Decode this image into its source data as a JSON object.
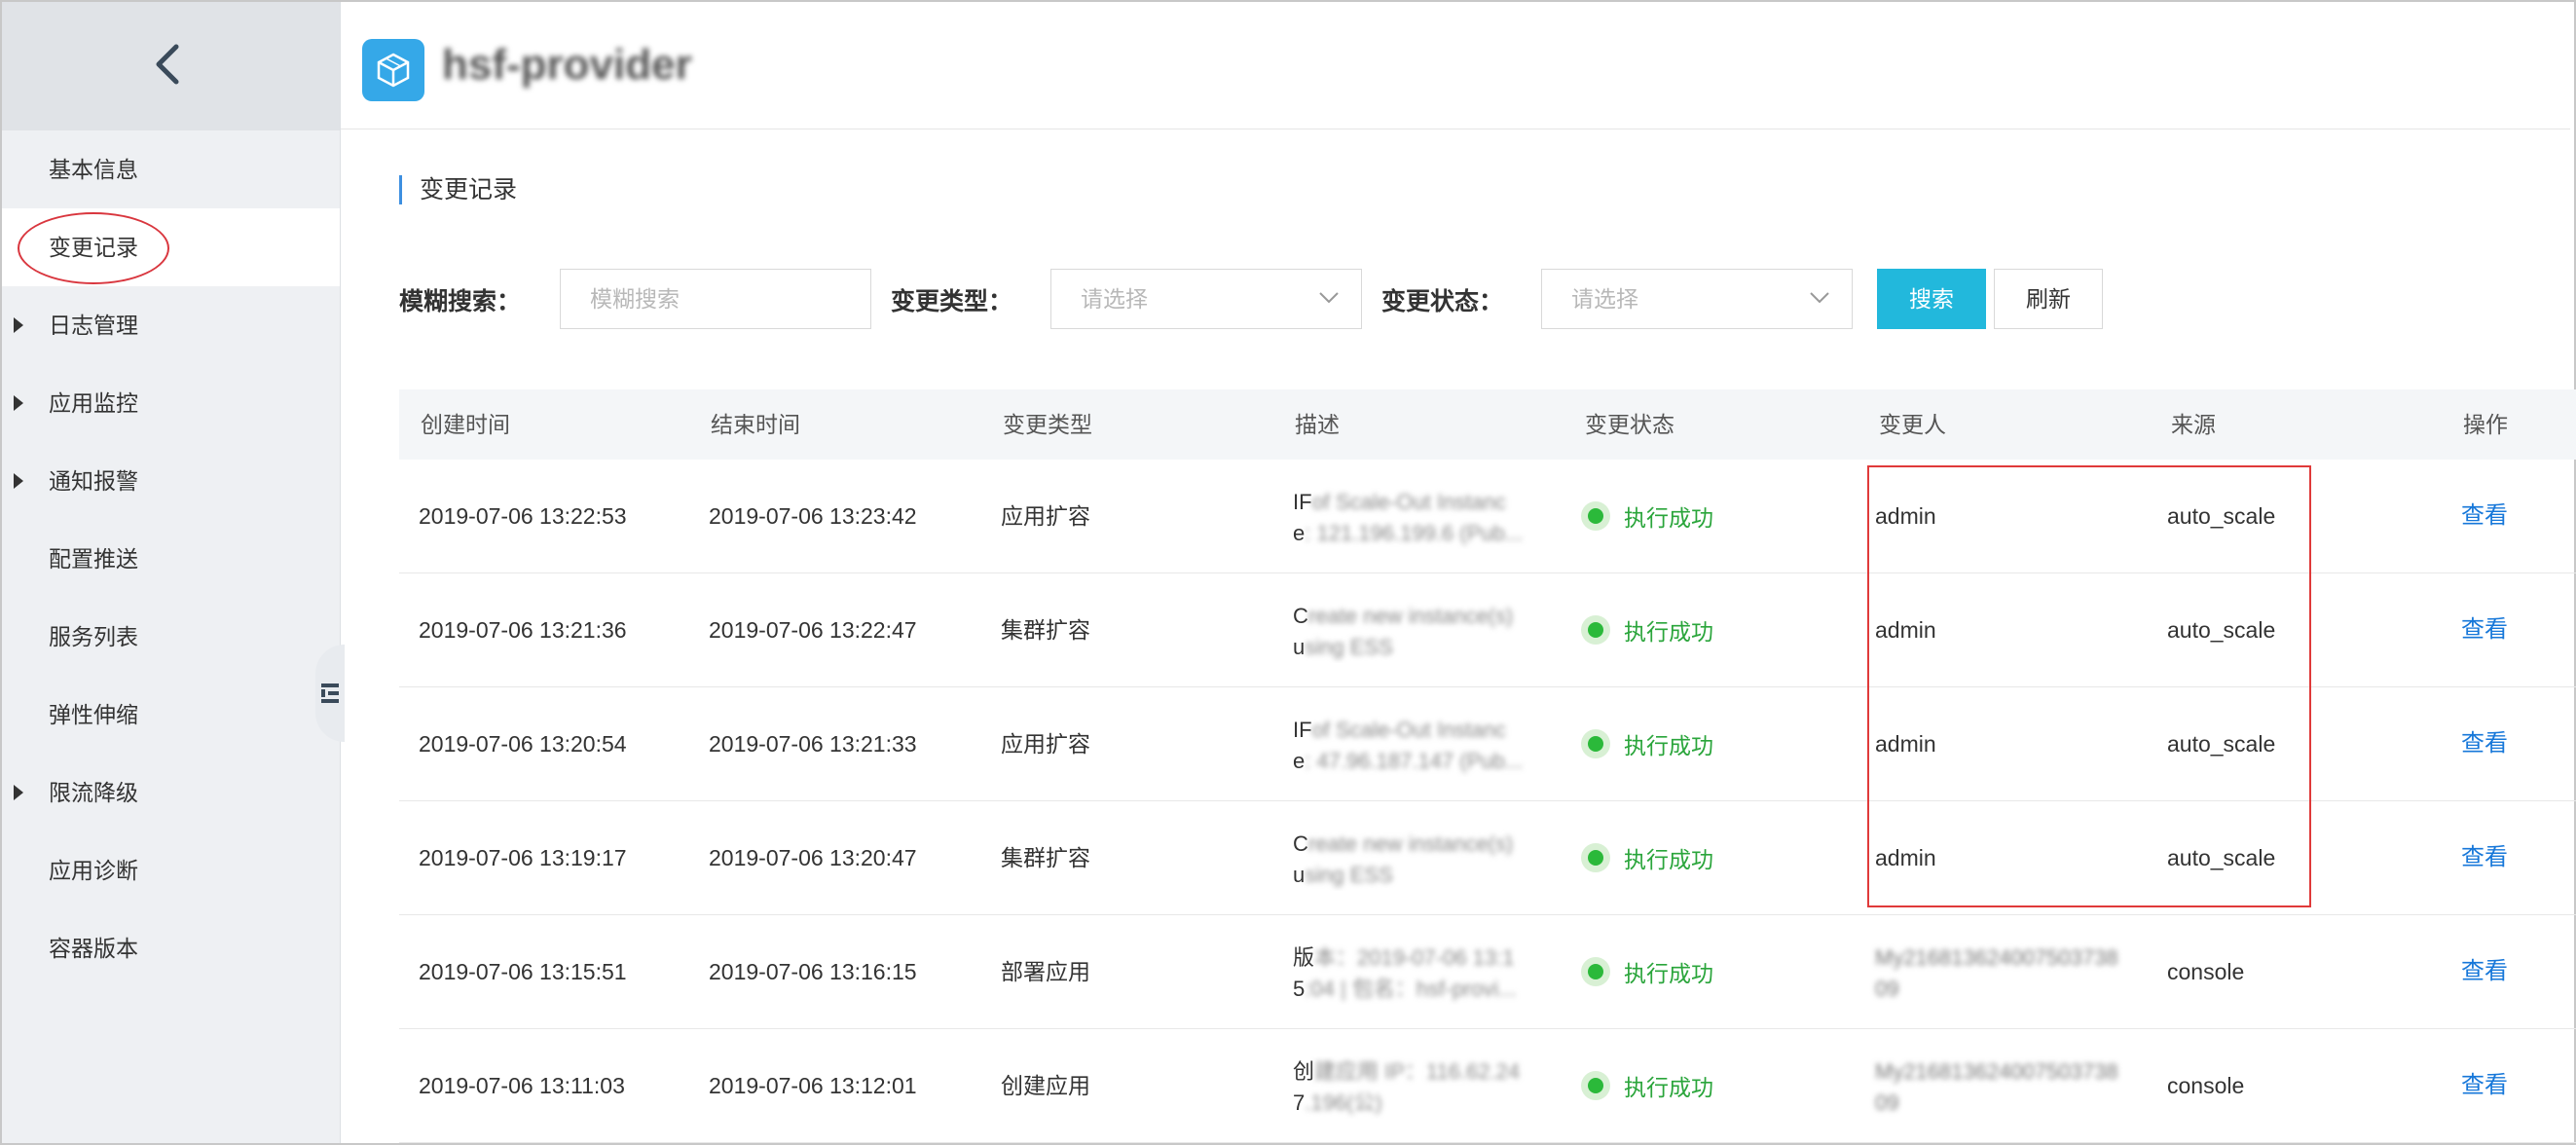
{
  "app": {
    "name": "hsf-provider"
  },
  "sidebar": {
    "items": [
      {
        "label": "基本信息",
        "has_caret": false,
        "active": false
      },
      {
        "label": "变更记录",
        "has_caret": false,
        "active": true
      },
      {
        "label": "日志管理",
        "has_caret": true,
        "active": false
      },
      {
        "label": "应用监控",
        "has_caret": true,
        "active": false
      },
      {
        "label": "通知报警",
        "has_caret": true,
        "active": false
      },
      {
        "label": "配置推送",
        "has_caret": false,
        "active": false
      },
      {
        "label": "服务列表",
        "has_caret": false,
        "active": false
      },
      {
        "label": "弹性伸缩",
        "has_caret": false,
        "active": false
      },
      {
        "label": "限流降级",
        "has_caret": true,
        "active": false
      },
      {
        "label": "应用诊断",
        "has_caret": false,
        "active": false
      },
      {
        "label": "容器版本",
        "has_caret": false,
        "active": false
      }
    ]
  },
  "main": {
    "section_title": "变更记录",
    "filters": {
      "fuzzy_label": "模糊搜索：",
      "fuzzy_placeholder": "模糊搜索",
      "type_label": "变更类型：",
      "type_placeholder": "请选择",
      "status_label": "变更状态：",
      "status_placeholder": "请选择",
      "search_button": "搜索",
      "refresh_button": "刷新"
    },
    "table": {
      "columns": [
        "创建时间",
        "结束时间",
        "变更类型",
        "描述",
        "变更状态",
        "变更人",
        "来源",
        "操作"
      ],
      "rows": [
        {
          "created": "2019-07-06 13:22:53",
          "ended": "2019-07-06 13:23:42",
          "type": "应用扩容",
          "desc_line1_start": "IF",
          "desc_line1_rest": "of Scale-Out Instanc",
          "desc_line2_start": "e",
          "desc_line2_rest": ": 121.196.199.6 (Pub...",
          "status": "执行成功",
          "operator": "admin",
          "source": "auto_scale",
          "action": "查看"
        },
        {
          "created": "2019-07-06 13:21:36",
          "ended": "2019-07-06 13:22:47",
          "type": "集群扩容",
          "desc_line1_start": "C",
          "desc_line1_rest": "reate new instance(s)",
          "desc_line2_start": "u",
          "desc_line2_rest": "sing ESS",
          "status": "执行成功",
          "operator": "admin",
          "source": "auto_scale",
          "action": "查看"
        },
        {
          "created": "2019-07-06 13:20:54",
          "ended": "2019-07-06 13:21:33",
          "type": "应用扩容",
          "desc_line1_start": "IF",
          "desc_line1_rest": "of Scale-Out Instanc",
          "desc_line2_start": "e",
          "desc_line2_rest": ": 47.96.187.147 (Pub...",
          "status": "执行成功",
          "operator": "admin",
          "source": "auto_scale",
          "action": "查看"
        },
        {
          "created": "2019-07-06 13:19:17",
          "ended": "2019-07-06 13:20:47",
          "type": "集群扩容",
          "desc_line1_start": "C",
          "desc_line1_rest": "reate new instance(s)",
          "desc_line2_start": "u",
          "desc_line2_rest": "sing ESS",
          "status": "执行成功",
          "operator": "admin",
          "source": "auto_scale",
          "action": "查看"
        },
        {
          "created": "2019-07-06 13:15:51",
          "ended": "2019-07-06 13:16:15",
          "type": "部署应用",
          "desc_line1_start": "版",
          "desc_line1_rest": "本：2019-07-06 13:1",
          "desc_line2_start": "5",
          "desc_line2_rest": ":04 | 包名：hsf-provi...",
          "status": "执行成功",
          "operator": "My21681362400750373809",
          "source": "console",
          "action": "查看"
        },
        {
          "created": "2019-07-06 13:11:03",
          "ended": "2019-07-06 13:12:01",
          "type": "创建应用",
          "desc_line1_start": "创",
          "desc_line1_rest": "建应用 IP：116.62.24",
          "desc_line2_start": "7",
          "desc_line2_rest": ".196(公)",
          "status": "执行成功",
          "operator": "My21681362400750373809",
          "source": "console",
          "action": "查看"
        }
      ]
    }
  }
}
